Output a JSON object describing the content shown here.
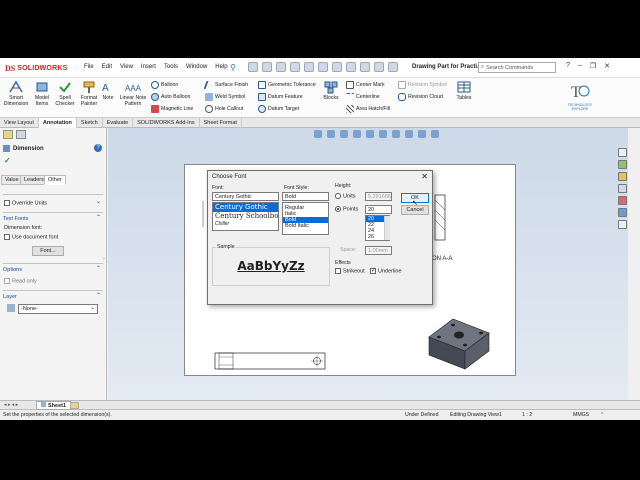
{
  "app": {
    "name": "SOLIDWORKS",
    "logo_mark": "DS",
    "menus": [
      "File",
      "Edit",
      "View",
      "Insert",
      "Tools",
      "Window",
      "Help"
    ],
    "document_title": "Drawing Part for Practi...",
    "search_placeholder": "Search Commands"
  },
  "ribbon": {
    "smart_dimension": "Smart Dimension",
    "model_items": "Model Items",
    "spell_checker": "Spell Checker",
    "format_painter": "Format Painter",
    "note": "Note",
    "linear_note_pattern": "Linear Note Pattern",
    "balloon": "Balloon",
    "auto_balloon": "Auto Balloon",
    "magnetic_line": "Magnetic Line",
    "surface_finish": "Surface Finish",
    "weld_symbol": "Weld Symbol",
    "hole_callout": "Hole Callout",
    "geometric_tolerance": "Geometric Tolerance",
    "datum_feature": "Datum Feature",
    "datum_target": "Datum Target",
    "blocks": "Blocks",
    "center_mark": "Center Mark",
    "centerline": "Centerline",
    "area_hatch_fill": "Area Hatch/Fill",
    "revision_symbol": "Revision Symbol",
    "revision_cloud": "Revision Cloud",
    "tables": "Tables",
    "watermark": "TECHNOLOGY EXPLORE"
  },
  "tabs": [
    "View Layout",
    "Annotation",
    "Sketch",
    "Evaluate",
    "SOLIDWORKS Add-Ins",
    "Sheet Format"
  ],
  "active_tab": "Annotation",
  "property_manager": {
    "title": "Dimension",
    "help": "?",
    "subtabs": [
      "Value",
      "Leaders",
      "Other"
    ],
    "override_units": "Override Units",
    "text_fonts": "Text Fonts",
    "dimension_font": "Dimension font:",
    "use_document_font": "Use document font",
    "font_button": "Font...",
    "options": "Options",
    "read_only": "Read only",
    "layer": "Layer",
    "layer_value": "-None-"
  },
  "dialog": {
    "title": "Choose Font",
    "font_label": "Font:",
    "font_value": "Century Gothic",
    "font_list": [
      "Century Gothic",
      "Century Schoolbo",
      "Chiller"
    ],
    "font_selected_index": 0,
    "style_label": "Font Style:",
    "style_value": "Bold",
    "style_list": [
      "Regular",
      "Italic",
      "Bold",
      "Bold Italic"
    ],
    "style_selected_index": 2,
    "height_label": "Height:",
    "units_label": "Units",
    "units_value": "5.2916666",
    "points_label": "Points",
    "points_value": "20",
    "points_list": [
      "20",
      "22",
      "24",
      "26"
    ],
    "points_selected_index": 0,
    "space_label": "Space:",
    "space_value": "1.00mm",
    "ok": "OK",
    "cancel": "Cancel",
    "sample_label": "Sample",
    "sample_text": "AaBbYyZz",
    "effects_label": "Effects",
    "strikeout": "Strikeout",
    "underline": "Underline",
    "strikeout_checked": false,
    "underline_checked": true
  },
  "drawing": {
    "section_label": "ON A-A"
  },
  "statusbar": {
    "message": "Set the properties of the selected dimension(s).",
    "state": "Under Defined",
    "editing": "Editing Drawing View1",
    "scale": "1 : 2",
    "units": "MMGS"
  },
  "sheet_tab": "Sheet1",
  "colors": {
    "brand": "#d21f26",
    "selection": "#0a6cd6",
    "accent": "#1a4a80"
  }
}
